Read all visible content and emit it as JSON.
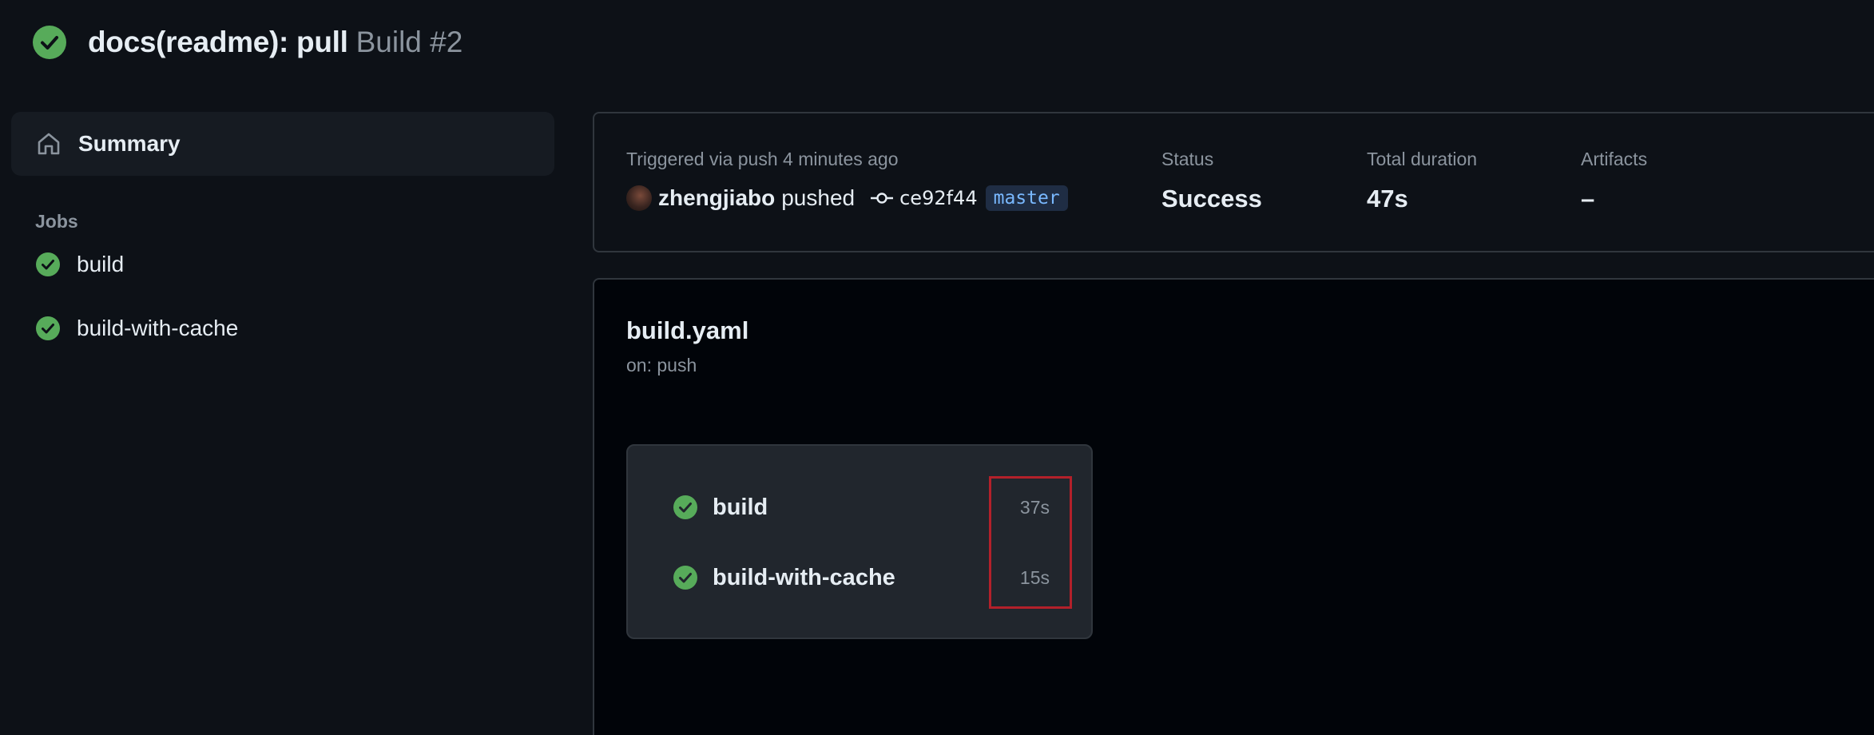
{
  "header": {
    "title": "docs(readme): pull",
    "run_label": "Build #2",
    "status_icon": "check-circle-icon",
    "status_color": "#57ab5a"
  },
  "sidebar": {
    "summary_label": "Summary",
    "jobs_heading": "Jobs",
    "jobs": [
      {
        "label": "build"
      },
      {
        "label": "build-with-cache"
      }
    ]
  },
  "run_info": {
    "trigger_text": "Triggered via push 4 minutes ago",
    "actor": "zhengjiabo",
    "action": "pushed",
    "commit_sha": "ce92f44",
    "branch": "master",
    "status_label": "Status",
    "status_value": "Success",
    "duration_label": "Total duration",
    "duration_value": "47s",
    "artifacts_label": "Artifacts",
    "artifacts_value": "–"
  },
  "workflow": {
    "file_name": "build.yaml",
    "trigger": "on: push",
    "jobs": [
      {
        "name": "build",
        "duration": "37s"
      },
      {
        "name": "build-with-cache",
        "duration": "15s"
      }
    ]
  },
  "colors": {
    "success": "#57ab5a",
    "background": "#0d1117",
    "panel": "#010409",
    "card": "#21262d",
    "highlight": "#b3202a",
    "branch_text": "#79b8ff"
  }
}
